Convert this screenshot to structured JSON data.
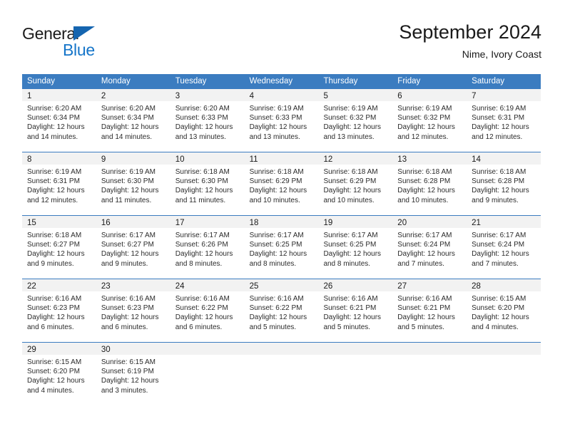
{
  "branding": {
    "name_part1": "General",
    "name_part2": "Blue"
  },
  "header": {
    "month_title": "September 2024",
    "location": "Nime, Ivory Coast"
  },
  "colors": {
    "header_blue": "#3b7cc0",
    "logo_blue": "#1575c9",
    "day_band_gray": "#f2f2f2"
  },
  "calendar": {
    "day_headers": [
      "Sunday",
      "Monday",
      "Tuesday",
      "Wednesday",
      "Thursday",
      "Friday",
      "Saturday"
    ],
    "weeks": [
      [
        {
          "day": "1",
          "sunrise": "Sunrise: 6:20 AM",
          "sunset": "Sunset: 6:34 PM",
          "daylight1": "Daylight: 12 hours",
          "daylight2": "and 14 minutes."
        },
        {
          "day": "2",
          "sunrise": "Sunrise: 6:20 AM",
          "sunset": "Sunset: 6:34 PM",
          "daylight1": "Daylight: 12 hours",
          "daylight2": "and 14 minutes."
        },
        {
          "day": "3",
          "sunrise": "Sunrise: 6:20 AM",
          "sunset": "Sunset: 6:33 PM",
          "daylight1": "Daylight: 12 hours",
          "daylight2": "and 13 minutes."
        },
        {
          "day": "4",
          "sunrise": "Sunrise: 6:19 AM",
          "sunset": "Sunset: 6:33 PM",
          "daylight1": "Daylight: 12 hours",
          "daylight2": "and 13 minutes."
        },
        {
          "day": "5",
          "sunrise": "Sunrise: 6:19 AM",
          "sunset": "Sunset: 6:32 PM",
          "daylight1": "Daylight: 12 hours",
          "daylight2": "and 13 minutes."
        },
        {
          "day": "6",
          "sunrise": "Sunrise: 6:19 AM",
          "sunset": "Sunset: 6:32 PM",
          "daylight1": "Daylight: 12 hours",
          "daylight2": "and 12 minutes."
        },
        {
          "day": "7",
          "sunrise": "Sunrise: 6:19 AM",
          "sunset": "Sunset: 6:31 PM",
          "daylight1": "Daylight: 12 hours",
          "daylight2": "and 12 minutes."
        }
      ],
      [
        {
          "day": "8",
          "sunrise": "Sunrise: 6:19 AM",
          "sunset": "Sunset: 6:31 PM",
          "daylight1": "Daylight: 12 hours",
          "daylight2": "and 12 minutes."
        },
        {
          "day": "9",
          "sunrise": "Sunrise: 6:19 AM",
          "sunset": "Sunset: 6:30 PM",
          "daylight1": "Daylight: 12 hours",
          "daylight2": "and 11 minutes."
        },
        {
          "day": "10",
          "sunrise": "Sunrise: 6:18 AM",
          "sunset": "Sunset: 6:30 PM",
          "daylight1": "Daylight: 12 hours",
          "daylight2": "and 11 minutes."
        },
        {
          "day": "11",
          "sunrise": "Sunrise: 6:18 AM",
          "sunset": "Sunset: 6:29 PM",
          "daylight1": "Daylight: 12 hours",
          "daylight2": "and 10 minutes."
        },
        {
          "day": "12",
          "sunrise": "Sunrise: 6:18 AM",
          "sunset": "Sunset: 6:29 PM",
          "daylight1": "Daylight: 12 hours",
          "daylight2": "and 10 minutes."
        },
        {
          "day": "13",
          "sunrise": "Sunrise: 6:18 AM",
          "sunset": "Sunset: 6:28 PM",
          "daylight1": "Daylight: 12 hours",
          "daylight2": "and 10 minutes."
        },
        {
          "day": "14",
          "sunrise": "Sunrise: 6:18 AM",
          "sunset": "Sunset: 6:28 PM",
          "daylight1": "Daylight: 12 hours",
          "daylight2": "and 9 minutes."
        }
      ],
      [
        {
          "day": "15",
          "sunrise": "Sunrise: 6:18 AM",
          "sunset": "Sunset: 6:27 PM",
          "daylight1": "Daylight: 12 hours",
          "daylight2": "and 9 minutes."
        },
        {
          "day": "16",
          "sunrise": "Sunrise: 6:17 AM",
          "sunset": "Sunset: 6:27 PM",
          "daylight1": "Daylight: 12 hours",
          "daylight2": "and 9 minutes."
        },
        {
          "day": "17",
          "sunrise": "Sunrise: 6:17 AM",
          "sunset": "Sunset: 6:26 PM",
          "daylight1": "Daylight: 12 hours",
          "daylight2": "and 8 minutes."
        },
        {
          "day": "18",
          "sunrise": "Sunrise: 6:17 AM",
          "sunset": "Sunset: 6:25 PM",
          "daylight1": "Daylight: 12 hours",
          "daylight2": "and 8 minutes."
        },
        {
          "day": "19",
          "sunrise": "Sunrise: 6:17 AM",
          "sunset": "Sunset: 6:25 PM",
          "daylight1": "Daylight: 12 hours",
          "daylight2": "and 8 minutes."
        },
        {
          "day": "20",
          "sunrise": "Sunrise: 6:17 AM",
          "sunset": "Sunset: 6:24 PM",
          "daylight1": "Daylight: 12 hours",
          "daylight2": "and 7 minutes."
        },
        {
          "day": "21",
          "sunrise": "Sunrise: 6:17 AM",
          "sunset": "Sunset: 6:24 PM",
          "daylight1": "Daylight: 12 hours",
          "daylight2": "and 7 minutes."
        }
      ],
      [
        {
          "day": "22",
          "sunrise": "Sunrise: 6:16 AM",
          "sunset": "Sunset: 6:23 PM",
          "daylight1": "Daylight: 12 hours",
          "daylight2": "and 6 minutes."
        },
        {
          "day": "23",
          "sunrise": "Sunrise: 6:16 AM",
          "sunset": "Sunset: 6:23 PM",
          "daylight1": "Daylight: 12 hours",
          "daylight2": "and 6 minutes."
        },
        {
          "day": "24",
          "sunrise": "Sunrise: 6:16 AM",
          "sunset": "Sunset: 6:22 PM",
          "daylight1": "Daylight: 12 hours",
          "daylight2": "and 6 minutes."
        },
        {
          "day": "25",
          "sunrise": "Sunrise: 6:16 AM",
          "sunset": "Sunset: 6:22 PM",
          "daylight1": "Daylight: 12 hours",
          "daylight2": "and 5 minutes."
        },
        {
          "day": "26",
          "sunrise": "Sunrise: 6:16 AM",
          "sunset": "Sunset: 6:21 PM",
          "daylight1": "Daylight: 12 hours",
          "daylight2": "and 5 minutes."
        },
        {
          "day": "27",
          "sunrise": "Sunrise: 6:16 AM",
          "sunset": "Sunset: 6:21 PM",
          "daylight1": "Daylight: 12 hours",
          "daylight2": "and 5 minutes."
        },
        {
          "day": "28",
          "sunrise": "Sunrise: 6:15 AM",
          "sunset": "Sunset: 6:20 PM",
          "daylight1": "Daylight: 12 hours",
          "daylight2": "and 4 minutes."
        }
      ],
      [
        {
          "day": "29",
          "sunrise": "Sunrise: 6:15 AM",
          "sunset": "Sunset: 6:20 PM",
          "daylight1": "Daylight: 12 hours",
          "daylight2": "and 4 minutes."
        },
        {
          "day": "30",
          "sunrise": "Sunrise: 6:15 AM",
          "sunset": "Sunset: 6:19 PM",
          "daylight1": "Daylight: 12 hours",
          "daylight2": "and 3 minutes."
        },
        {
          "day": "",
          "sunrise": "",
          "sunset": "",
          "daylight1": "",
          "daylight2": ""
        },
        {
          "day": "",
          "sunrise": "",
          "sunset": "",
          "daylight1": "",
          "daylight2": ""
        },
        {
          "day": "",
          "sunrise": "",
          "sunset": "",
          "daylight1": "",
          "daylight2": ""
        },
        {
          "day": "",
          "sunrise": "",
          "sunset": "",
          "daylight1": "",
          "daylight2": ""
        },
        {
          "day": "",
          "sunrise": "",
          "sunset": "",
          "daylight1": "",
          "daylight2": ""
        }
      ]
    ]
  }
}
